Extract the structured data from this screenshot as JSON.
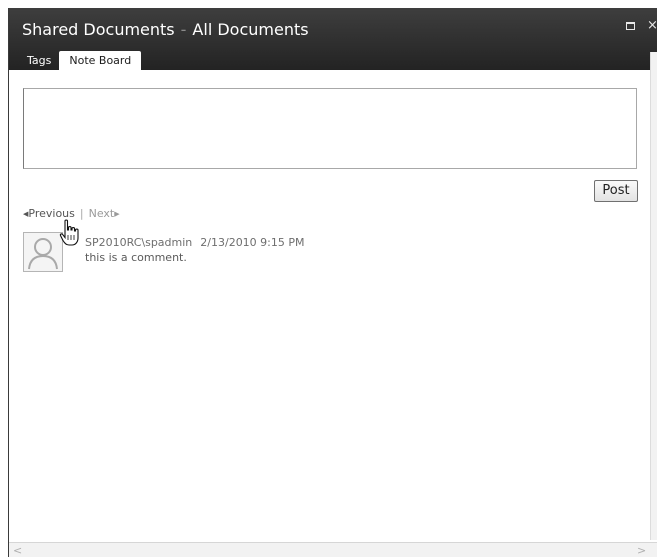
{
  "window": {
    "title_library": "Shared Documents",
    "title_separator": "-",
    "title_view": "All Documents",
    "maximize_label": "",
    "close_label": "×"
  },
  "tabs": [
    {
      "label": "Tags",
      "active": false
    },
    {
      "label": "Note Board",
      "active": true
    }
  ],
  "note_board": {
    "input_value": "",
    "post_label": "Post"
  },
  "pager": {
    "prev_arrow": "◀",
    "prev_label": "Previous",
    "divider": "|",
    "next_label": "Next",
    "next_arrow": "▶"
  },
  "comments": [
    {
      "author": "SP2010RC\\spadmin",
      "date": "2/13/2010 9:15 PM",
      "text": "this is a comment."
    }
  ],
  "scrollbars": {
    "left_arrow": "<",
    "right_arrow": ">"
  },
  "colors": {
    "titlebar": "#2c2c2c",
    "title_text": "#ffffff",
    "tab_active_bg": "#ffffff",
    "muted_text": "#7f7f7f"
  },
  "icons": {
    "avatar": "user-placeholder-icon",
    "cursor": "hand-pointer-icon",
    "close": "close-icon",
    "maximize": "maximize-icon"
  }
}
